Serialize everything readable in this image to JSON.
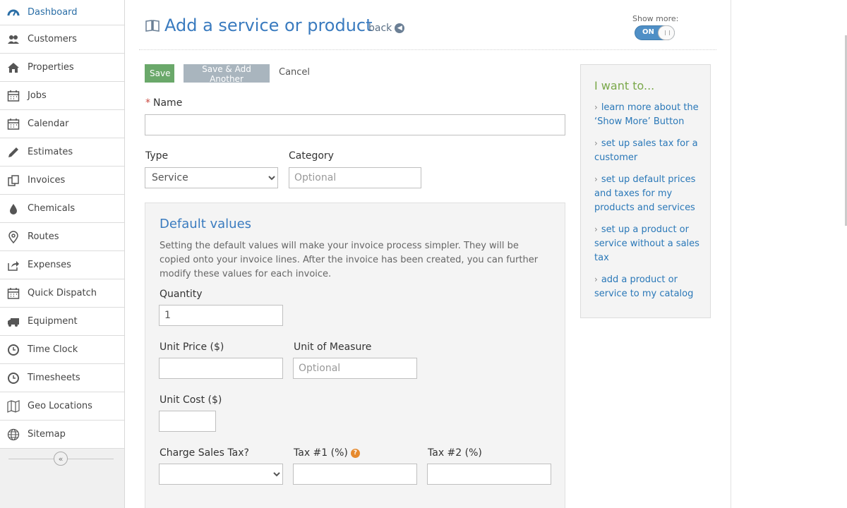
{
  "sidebar": {
    "items": [
      {
        "label": "Dashboard",
        "icon": "dashboard-icon",
        "active": true
      },
      {
        "label": "Customers",
        "icon": "users-icon"
      },
      {
        "label": "Properties",
        "icon": "home-icon"
      },
      {
        "label": "Jobs",
        "icon": "calendar-icon"
      },
      {
        "label": "Calendar",
        "icon": "calendar-icon"
      },
      {
        "label": "Estimates",
        "icon": "pencil-icon"
      },
      {
        "label": "Invoices",
        "icon": "copy-icon"
      },
      {
        "label": "Chemicals",
        "icon": "drop-icon"
      },
      {
        "label": "Routes",
        "icon": "map-pin-icon"
      },
      {
        "label": "Expenses",
        "icon": "share-icon"
      },
      {
        "label": "Quick Dispatch",
        "icon": "calendar-icon"
      },
      {
        "label": "Equipment",
        "icon": "truck-icon"
      },
      {
        "label": "Time Clock",
        "icon": "clock-icon"
      },
      {
        "label": "Timesheets",
        "icon": "clock-icon"
      },
      {
        "label": "Geo Locations",
        "icon": "map-icon"
      },
      {
        "label": "Sitemap",
        "icon": "globe-icon"
      }
    ],
    "collapse_glyph": "«"
  },
  "header": {
    "title": "Add a service or product",
    "back_label": "back",
    "show_more_label": "Show more:",
    "toggle_label": "ON"
  },
  "toolbar": {
    "save_label": "Save",
    "save_add_label": "Save & Add Another",
    "cancel_label": "Cancel"
  },
  "form": {
    "name_required_mark": "*",
    "name_label": "Name",
    "name_value": "",
    "type_label": "Type",
    "type_value": "Service",
    "category_label": "Category",
    "category_placeholder": "Optional"
  },
  "defaults": {
    "title": "Default values",
    "description": "Setting the default values will make your invoice process simpler. They will be copied onto your invoice lines. After the invoice has been created, you can further modify these values for each invoice.",
    "quantity_label": "Quantity",
    "quantity_value": "1",
    "unit_price_label": "Unit Price ($)",
    "unit_of_measure_label": "Unit of Measure",
    "unit_of_measure_placeholder": "Optional",
    "unit_cost_label": "Unit Cost ($)",
    "charge_sales_tax_label": "Charge Sales Tax?",
    "tax1_label": "Tax #1 (%)",
    "tax1_help_glyph": "?",
    "tax2_label": "Tax #2 (%)"
  },
  "help": {
    "title": "I want to...",
    "links": [
      "learn more about the ‘Show More’ Button",
      "set up sales tax for a customer",
      "set up default prices and taxes for my products and services",
      "set up a product or service without a sales tax",
      "add a product or service to my catalog"
    ]
  },
  "colors": {
    "accent": "#3a7bbf",
    "save": "#6aa86a",
    "help_title": "#7aa84a",
    "link": "#2a78b8"
  }
}
